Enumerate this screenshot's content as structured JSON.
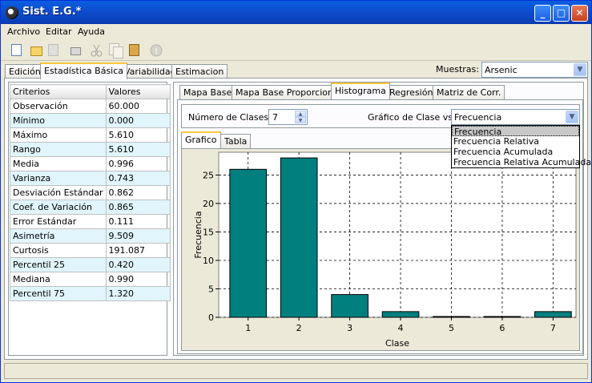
{
  "window": {
    "title": "Sist. E.G.*",
    "controls": [
      "_",
      "□",
      "✕"
    ]
  },
  "menu": [
    "Archivo",
    "Editar",
    "Ayuda"
  ],
  "toolbar_icons": [
    "new-file-icon",
    "open-folder-icon",
    "save-icon",
    "print-icon",
    "cut-icon",
    "copy-icon",
    "paste-icon",
    "info-icon"
  ],
  "main_tabs": [
    "Edición",
    "Estadística Básica",
    "Variabilidad",
    "Estimacion"
  ],
  "muestras": {
    "label": "Muestras:",
    "value": "Arsenic"
  },
  "stats": {
    "headers": [
      "Criterios",
      "Valores"
    ],
    "rows": [
      [
        "Observación",
        "60.000"
      ],
      [
        "Mínimo",
        "0.000"
      ],
      [
        "Máximo",
        "5.610"
      ],
      [
        "Rango",
        "5.610"
      ],
      [
        "Media",
        "0.996"
      ],
      [
        "Varianza",
        "0.743"
      ],
      [
        "Desviación Estándar",
        "0.862"
      ],
      [
        "Coef. de Variación",
        "0.865"
      ],
      [
        "Error Estándar",
        "0.111"
      ],
      [
        "Asimetría",
        "9.509"
      ],
      [
        "Curtosis",
        "191.087"
      ],
      [
        "Percentil 25",
        "0.420"
      ],
      [
        "Mediana",
        "0.990"
      ],
      [
        "Percentil 75",
        "1.320"
      ]
    ]
  },
  "sub_tabs": [
    "Mapa Base",
    "Mapa Base Proporcional",
    "Histograma",
    "Regresión",
    "Matriz de Corr."
  ],
  "controls": {
    "num_clases_label": "Número de Clases:",
    "num_clases_value": "7",
    "grafico_label": "Gráfico de Clase vs:",
    "grafico_value": "Frecuencia",
    "grafico_options": [
      "Frecuencia",
      "Frecuencia Relativa",
      "Frecuencia Acumulada",
      "Frecuencia Relativa Acumulada"
    ]
  },
  "chart_tabs": [
    "Grafico",
    "Tabla"
  ],
  "chart_data": {
    "type": "bar",
    "categories": [
      "1",
      "2",
      "3",
      "4",
      "5",
      "6",
      "7"
    ],
    "values": [
      26,
      28,
      4,
      1,
      0,
      0,
      1
    ],
    "xlabel": "Clase",
    "ylabel": "Frecuencia",
    "ylim": [
      0,
      29
    ],
    "yticks": [
      "0",
      "5",
      "10",
      "15",
      "20",
      "25"
    ],
    "grid": true,
    "bar_color": "#007f7f"
  }
}
